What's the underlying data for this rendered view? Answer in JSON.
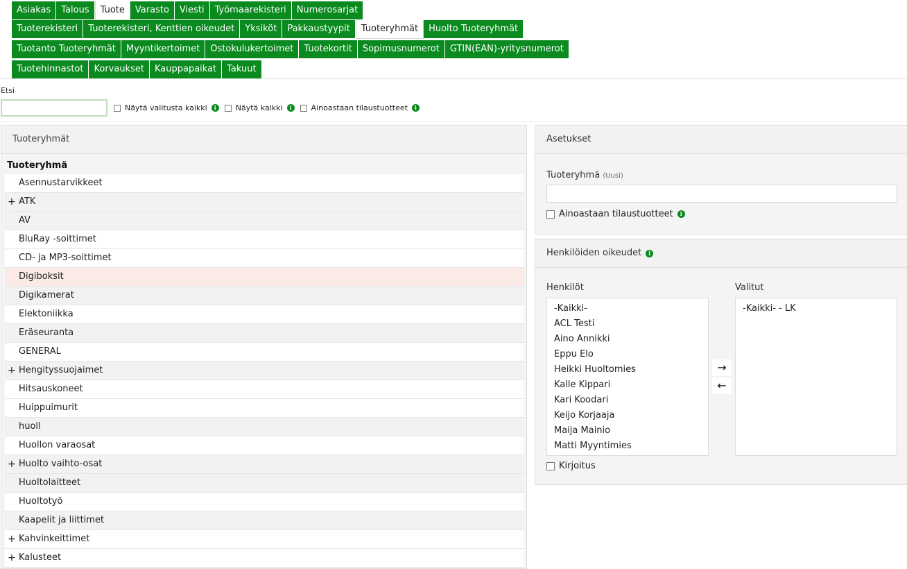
{
  "nav": {
    "row1": [
      "Asiakas",
      "Talous",
      "Tuote",
      "Varasto",
      "Viesti",
      "Työmaarekisteri",
      "Numerosarjat"
    ],
    "row1_active": 2,
    "row2": [
      "Tuoterekisteri",
      "Tuoterekisteri, Kenttien oikeudet",
      "Yksiköt",
      "Pakkaustyypit",
      "Tuoteryhmät",
      "Huolto Tuoteryhmät"
    ],
    "row2_active": 4,
    "row3": [
      "Tuotanto Tuoteryhmät",
      "Myyntikertoimet",
      "Ostokulukertoimet",
      "Tuotekortit",
      "Sopimusnumerot",
      "GTIN(EAN)-yritysnumerot"
    ],
    "row4": [
      "Tuotehinnastot",
      "Korvaukset",
      "Kauppapaikat",
      "Takuut"
    ]
  },
  "search": {
    "label": "Etsi",
    "value": "",
    "opt1": "Näytä valitusta kaikki",
    "opt2": "Näytä kaikki",
    "opt3": "Ainoastaan tilaustuotteet"
  },
  "left_panel": {
    "title": "Tuoteryhmät",
    "group_title": "Tuoteryhmä",
    "rows": [
      {
        "label": "Asennustarvikkeet",
        "expandable": false,
        "style": "white"
      },
      {
        "label": "ATK",
        "expandable": true,
        "style": "grey"
      },
      {
        "label": "AV",
        "expandable": false,
        "style": "grey"
      },
      {
        "label": "BluRay -soittimet",
        "expandable": false,
        "style": "white"
      },
      {
        "label": "CD- ja MP3-soittimet",
        "expandable": false,
        "style": "white"
      },
      {
        "label": "Digiboksit",
        "expandable": false,
        "style": "hl"
      },
      {
        "label": "Digikamerat",
        "expandable": false,
        "style": "grey"
      },
      {
        "label": "Elektoniikka",
        "expandable": false,
        "style": "white"
      },
      {
        "label": "Eräseuranta",
        "expandable": false,
        "style": "grey"
      },
      {
        "label": "GENERAL",
        "expandable": false,
        "style": "white"
      },
      {
        "label": "Hengityssuojaimet",
        "expandable": true,
        "style": "grey"
      },
      {
        "label": "Hitsauskoneet",
        "expandable": false,
        "style": "white"
      },
      {
        "label": "Huippuimurit",
        "expandable": false,
        "style": "white"
      },
      {
        "label": "huoll",
        "expandable": false,
        "style": "grey"
      },
      {
        "label": "Huollon varaosat",
        "expandable": false,
        "style": "white"
      },
      {
        "label": "Huolto vaihto-osat",
        "expandable": true,
        "style": "grey"
      },
      {
        "label": "Huoltolaitteet",
        "expandable": false,
        "style": "grey"
      },
      {
        "label": "Huoltotyö",
        "expandable": false,
        "style": "white"
      },
      {
        "label": "Kaapelit ja liittimet",
        "expandable": false,
        "style": "grey"
      },
      {
        "label": "Kahvinkeittimet",
        "expandable": true,
        "style": "white"
      },
      {
        "label": "Kalusteet",
        "expandable": true,
        "style": "white"
      }
    ]
  },
  "settings": {
    "title": "Asetukset",
    "field_label": "Tuoteryhmä",
    "field_hint": "(Uusi)",
    "field_value": "",
    "checkbox_label": "Ainoastaan tilaustuotteet"
  },
  "rights": {
    "title": "Henkilöiden oikeudet",
    "persons_label": "Henkilöt",
    "selected_label": "Valitut",
    "persons": [
      "-Kaikki-",
      "ACL Testi",
      "Aino Annikki",
      "Eppu Elo",
      "Heikki Huoltomies",
      "Kalle Kippari",
      "Kari Koodari",
      "Keijo Korjaaja",
      "Maija Mainio",
      "Matti Myyntimies"
    ],
    "selected": [
      "-Kaikki- - LK"
    ],
    "arrow_right": "→",
    "arrow_left": "←",
    "write_label": "Kirjoitus"
  },
  "colors": {
    "accent": "#0a8a1f",
    "highlight_row": "#fbeae6"
  }
}
